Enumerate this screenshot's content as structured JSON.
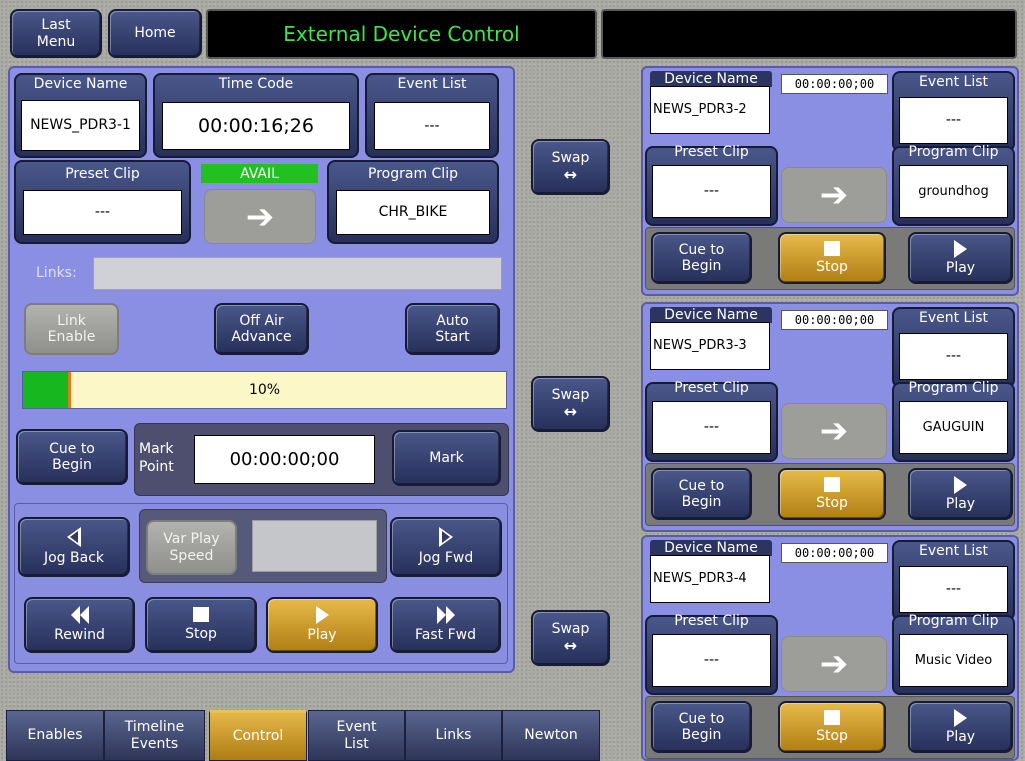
{
  "header": {
    "last_menu": "Last Menu",
    "home": "Home",
    "title": "External Device Control",
    "right_status": ""
  },
  "main_device": {
    "device_name_label": "Device Name",
    "device_name": "NEWS_PDR3-1",
    "time_code_label": "Time Code",
    "time_code": "00:00:16;26",
    "event_list_label": "Event List",
    "event_list": "---",
    "preset_clip_label": "Preset Clip",
    "preset_clip": "---",
    "status": "AVAIL",
    "program_clip_label": "Program Clip",
    "program_clip": "CHR_BIKE",
    "links_label": "Links:",
    "links_value": "",
    "link_enable": "Link Enable",
    "off_air_advance": "Off Air Advance",
    "auto_start": "Auto Start",
    "progress_label": "10%",
    "progress_fraction": 0.1,
    "cue_to_begin": "Cue to Begin",
    "mark_point_label": "Mark Point",
    "mark_point_value": "00:00:00;00",
    "mark": "Mark",
    "jog_back": "Jog Back",
    "var_play_speed": "Var Play Speed",
    "var_play_value": "",
    "jog_fwd": "Jog Fwd",
    "rewind": "Rewind",
    "stop": "Stop",
    "play": "Play",
    "fast_fwd": "Fast Fwd"
  },
  "swap": {
    "label": "Swap",
    "icon": "↔"
  },
  "side_devices": [
    {
      "device_name_label": "Device Name",
      "device_name": "NEWS_PDR3-2",
      "time_code": "00:00:00;00",
      "event_list_label": "Event List",
      "event_list": "---",
      "preset_clip_label": "Preset Clip",
      "preset_clip": "---",
      "program_clip_label": "Program Clip",
      "program_clip": "groundhog",
      "cue_to_begin": "Cue to Begin",
      "stop": "Stop",
      "play": "Play"
    },
    {
      "device_name_label": "Device Name",
      "device_name": "NEWS_PDR3-3",
      "time_code": "00:00:00;00",
      "event_list_label": "Event List",
      "event_list": "---",
      "preset_clip_label": "Preset Clip",
      "preset_clip": "---",
      "program_clip_label": "Program Clip",
      "program_clip": "GAUGUIN",
      "cue_to_begin": "Cue to Begin",
      "stop": "Stop",
      "play": "Play"
    },
    {
      "device_name_label": "Device Name",
      "device_name": "NEWS_PDR3-4",
      "time_code": "00:00:00;00",
      "event_list_label": "Event List",
      "event_list": "---",
      "preset_clip_label": "Preset Clip",
      "preset_clip": "---",
      "program_clip_label": "Program Clip",
      "program_clip": "Music Video",
      "cue_to_begin": "Cue to Begin",
      "stop": "Stop",
      "play": "Play"
    }
  ],
  "tabs": [
    {
      "label": "Enables"
    },
    {
      "label": "Timeline Events"
    },
    {
      "label": "Control",
      "active": true
    },
    {
      "label": "Event List"
    },
    {
      "label": "Links"
    },
    {
      "label": "Newton"
    }
  ],
  "icons": {
    "arrow_right": "➔"
  },
  "colors": {
    "panel": "#8b8fe3",
    "button": "#2f3a68",
    "active_gold": "#d4a12c",
    "status_green": "#22c022",
    "progress_bg": "#fbf7c7"
  }
}
